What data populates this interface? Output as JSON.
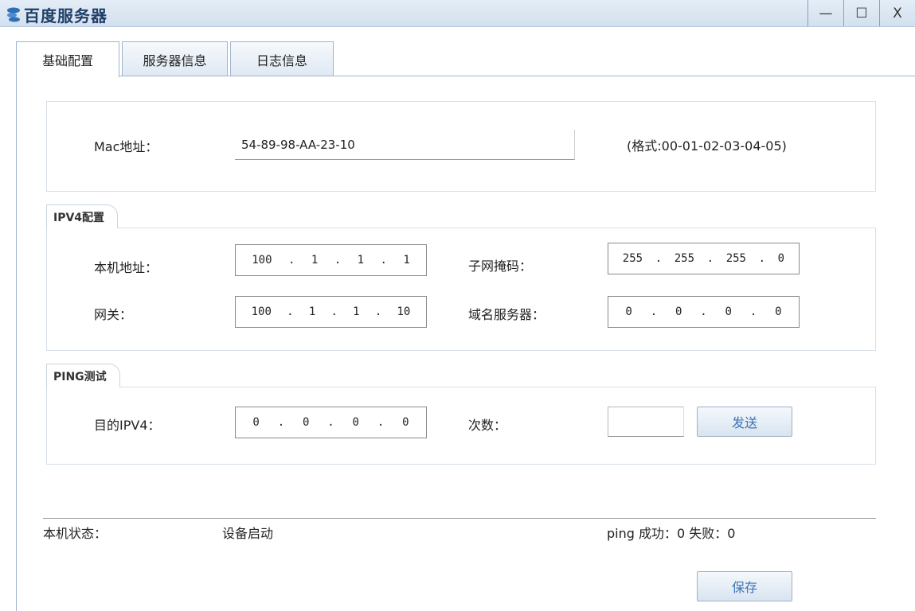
{
  "window": {
    "title": "百度服务器",
    "minimize_label": "—",
    "maximize_label": "☐",
    "close_label": "X"
  },
  "tabs": [
    {
      "label": "基础配置",
      "active": true
    },
    {
      "label": "服务器信息",
      "active": false
    },
    {
      "label": "日志信息",
      "active": false
    }
  ],
  "mac": {
    "label": "Mac地址：",
    "value": "54-89-98-AA-23-10",
    "format_hint": "(格式:00-01-02-03-04-05)"
  },
  "ipv4": {
    "legend": "IPV4配置",
    "host_address": {
      "label": "本机地址：",
      "octets": [
        "100",
        "1",
        "1",
        "1"
      ]
    },
    "subnet_mask": {
      "label": "子网掩码：",
      "octets": [
        "255",
        "255",
        "255",
        "0"
      ]
    },
    "gateway": {
      "label": "网关：",
      "octets": [
        "100",
        "1",
        "1",
        "10"
      ]
    },
    "dns_server": {
      "label": "域名服务器：",
      "octets": [
        "0",
        "0",
        "0",
        "0"
      ]
    }
  },
  "ping": {
    "legend": "PING测试",
    "target_label": "目的IPV4：",
    "target_octets": [
      "0",
      "0",
      "0",
      "0"
    ],
    "count_label": "次数：",
    "count_value": "",
    "send_label": "发送"
  },
  "status": {
    "host_status_label": "本机状态：",
    "host_status_value": "设备启动",
    "ping_result": "ping 成功：0 失败：0"
  },
  "save_label": "保存",
  "colors": {
    "titlebar": "#d3e0ef",
    "button_text": "#3c74b8",
    "border": "#9fb4cc"
  }
}
